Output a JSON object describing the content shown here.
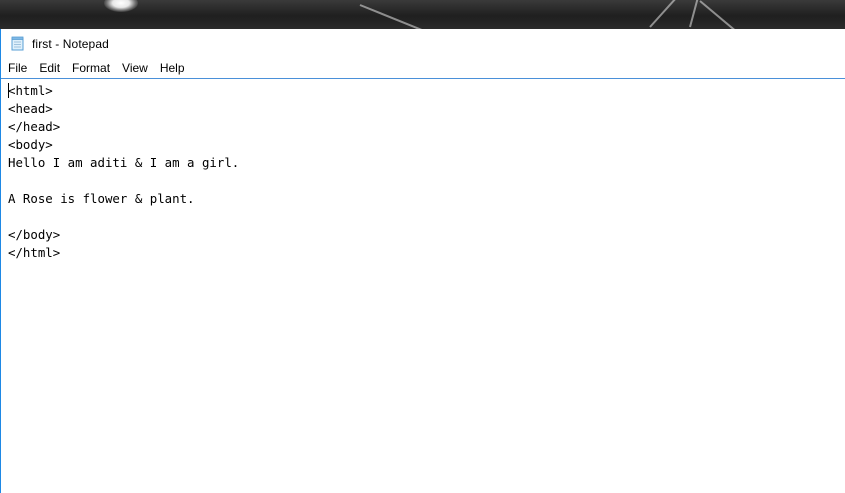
{
  "window": {
    "title": "first - Notepad",
    "app_icon": "notepad-icon",
    "accent_color": "#1e88e5"
  },
  "menu": {
    "items": [
      {
        "label": "File"
      },
      {
        "label": "Edit"
      },
      {
        "label": "Format"
      },
      {
        "label": "View"
      },
      {
        "label": "Help"
      }
    ]
  },
  "editor": {
    "content": "<html>\n<head>\n</head>\n<body>\nHello I am aditi & I am a girl.\n\nA Rose is flower & plant.\n\n</body>\n</html>"
  }
}
